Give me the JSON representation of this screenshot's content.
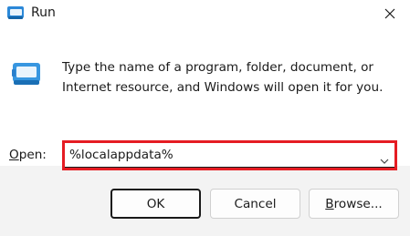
{
  "window": {
    "title": "Run",
    "icon": "run-dialog-icon",
    "close_icon": "close-icon"
  },
  "main": {
    "icon": "run-dialog-icon",
    "description": "Type the name of a program, folder, document, or Internet resource, and Windows will open it for you."
  },
  "open": {
    "label_accel": "O",
    "label_rest": "pen:",
    "value": "%localappdata%",
    "dropdown_icon": "chevron-down-icon",
    "highlight_color": "#e51c23"
  },
  "buttons": {
    "ok_label": "OK",
    "cancel_label": "Cancel",
    "browse_accel": "B",
    "browse_rest": "rowse..."
  }
}
